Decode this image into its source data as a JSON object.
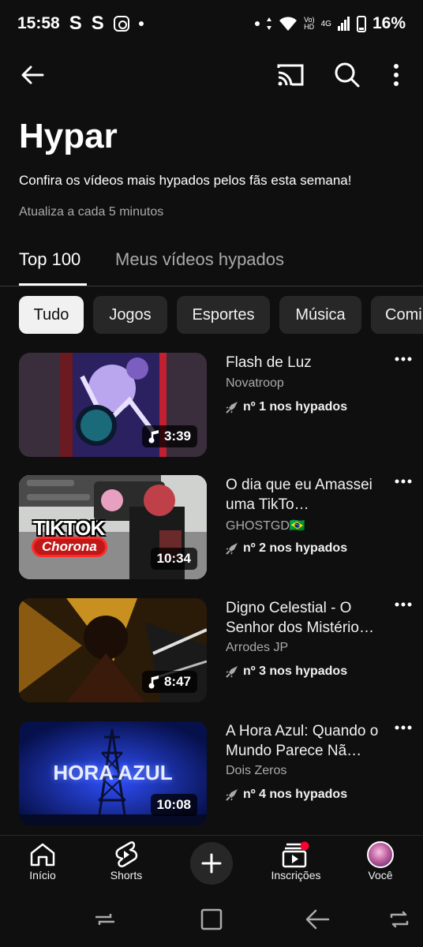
{
  "status": {
    "time": "15:58",
    "notif1": "S",
    "notif2": "S",
    "net_label_top": "Vo)",
    "net_label_bottom": "HD",
    "net_type": "4G",
    "battery": "16%"
  },
  "header": {
    "title": "Hypar",
    "subtitle": "Confira os vídeos mais hypados pelos fãs esta semana!",
    "update_note": "Atualiza a cada 5 minutos"
  },
  "tabs": [
    {
      "label": "Top 100",
      "active": true
    },
    {
      "label": "Meus vídeos hypados",
      "active": false
    }
  ],
  "chips": [
    {
      "label": "Tudo",
      "active": true
    },
    {
      "label": "Jogos",
      "active": false
    },
    {
      "label": "Esportes",
      "active": false
    },
    {
      "label": "Música",
      "active": false
    },
    {
      "label": "Comi",
      "active": false
    }
  ],
  "videos": [
    {
      "title": "Flash de Luz",
      "channel": "Novatroop",
      "rank": "nº 1 nos hypados",
      "duration": "3:39",
      "music": true
    },
    {
      "title": "O dia que eu Amassei uma TikTo…",
      "channel": "GHOSTGD🇧🇷",
      "rank": "nº 2 nos hypados",
      "duration": "10:34",
      "music": false,
      "thumb_text_1": "TIKTOK",
      "thumb_text_2": "Chorona"
    },
    {
      "title": "Digno Celestial - O Senhor dos Mistério…",
      "channel": "Arrodes JP",
      "rank": "nº 3 nos hypados",
      "duration": "8:47",
      "music": true
    },
    {
      "title": "A Hora Azul: Quando o Mundo Parece Nã…",
      "channel": "Dois Zeros",
      "rank": "nº 4 nos hypados",
      "duration": "10:08",
      "music": false,
      "thumb_text_1": "HORA AZUL"
    }
  ],
  "nav": [
    {
      "label": "Início"
    },
    {
      "label": "Shorts"
    },
    {
      "label": "Inscrições"
    },
    {
      "label": "Você"
    }
  ],
  "colors": {
    "background": "#0f0f0f",
    "chip": "#272727",
    "notification_dot": "#ff0033"
  }
}
